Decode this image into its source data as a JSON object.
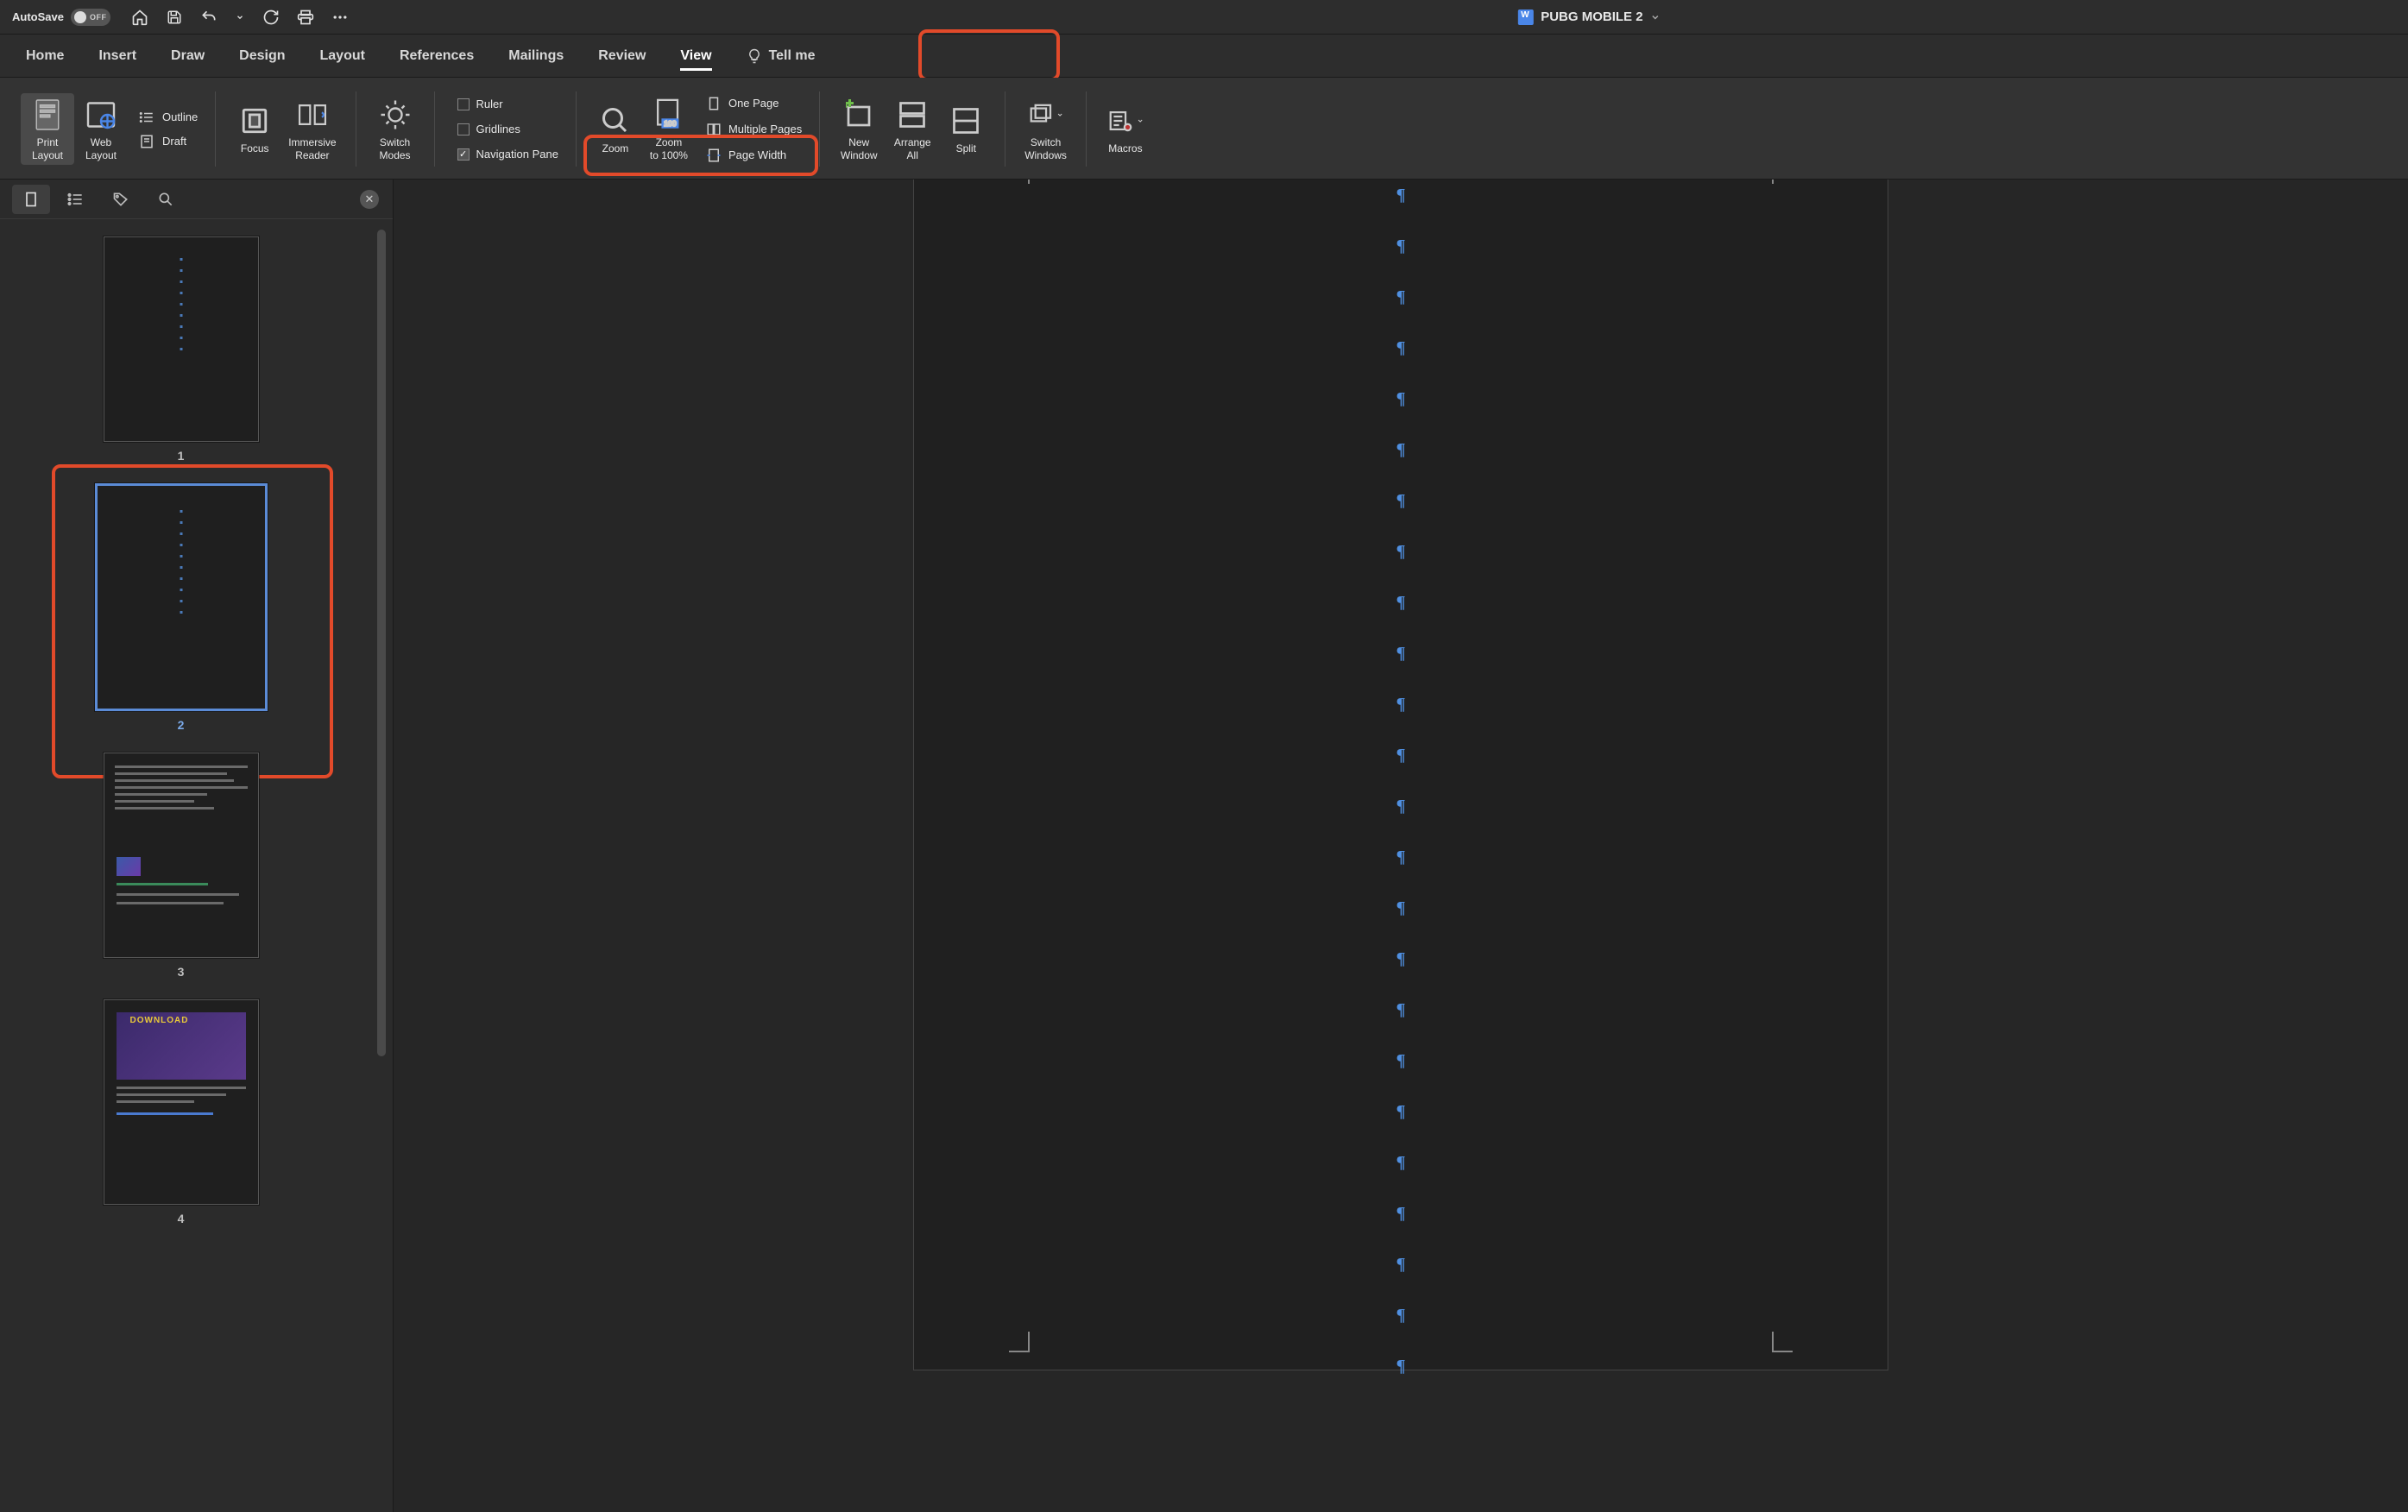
{
  "titlebar": {
    "autosave": "AutoSave",
    "autosave_state": "OFF",
    "doc_name": "PUBG MOBILE 2"
  },
  "menu": {
    "home": "Home",
    "insert": "Insert",
    "draw": "Draw",
    "design": "Design",
    "layout": "Layout",
    "references": "References",
    "mailings": "Mailings",
    "review": "Review",
    "view": "View",
    "tellme": "Tell me"
  },
  "ribbon": {
    "print_layout": "Print\nLayout",
    "web_layout": "Web\nLayout",
    "outline": "Outline",
    "draft": "Draft",
    "focus": "Focus",
    "immersive_reader": "Immersive\nReader",
    "switch_modes": "Switch\nModes",
    "ruler": "Ruler",
    "gridlines": "Gridlines",
    "nav_pane": "Navigation Pane",
    "zoom": "Zoom",
    "zoom_100": "Zoom\nto 100%",
    "one_page": "One Page",
    "multiple_pages": "Multiple Pages",
    "page_width": "Page Width",
    "new_window": "New\nWindow",
    "arrange_all": "Arrange\nAll",
    "split": "Split",
    "switch_windows": "Switch\nWindows",
    "macros": "Macros"
  },
  "nav": {
    "thumbs": [
      {
        "num": "1"
      },
      {
        "num": "2"
      },
      {
        "num": "3"
      },
      {
        "num": "4"
      }
    ]
  }
}
